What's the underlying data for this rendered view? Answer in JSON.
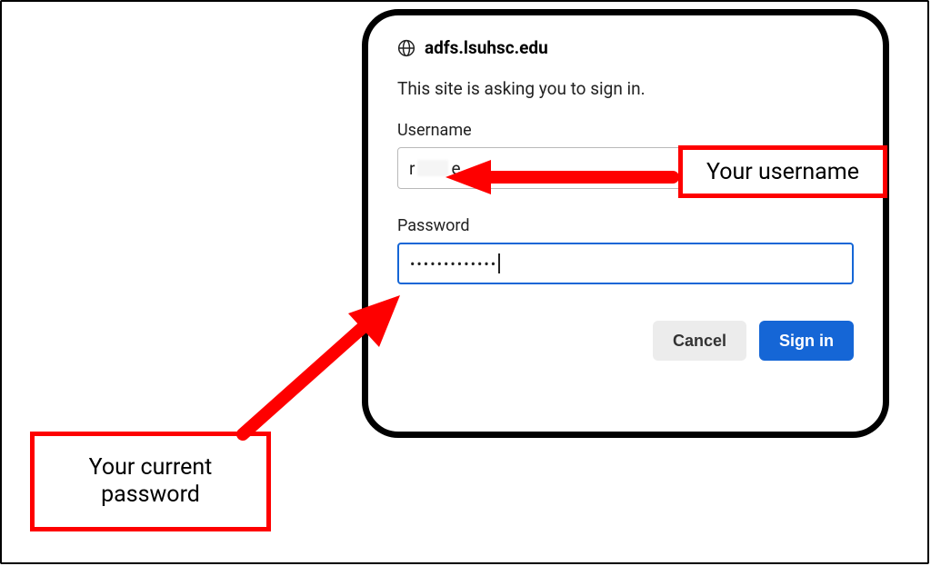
{
  "dialog": {
    "site": "adfs.lsuhsc.edu",
    "prompt": "This site is asking you to sign in.",
    "username_label": "Username",
    "username_char1": "r",
    "username_char2": "e",
    "password_label": "Password",
    "password_mask": "•••••••••••••",
    "cancel_label": "Cancel",
    "signin_label": "Sign in"
  },
  "annotations": {
    "username_callout": "Your username",
    "password_callout": "Your current password"
  }
}
